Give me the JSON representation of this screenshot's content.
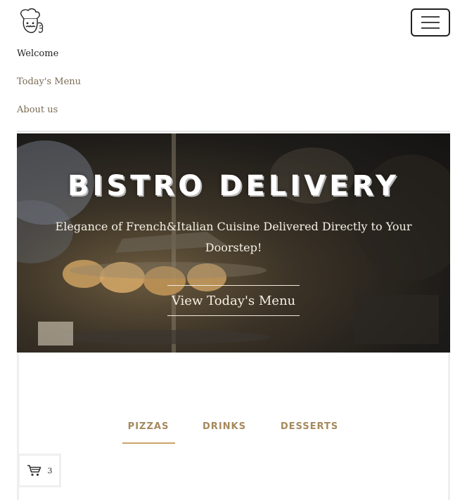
{
  "nav": {
    "items": [
      {
        "label": "Welcome"
      },
      {
        "label": "Today's Menu"
      },
      {
        "label": "About us"
      }
    ]
  },
  "hero": {
    "title": "BISTRO DELIVERY",
    "subtitle": "Elegance of French&Italian Cuisine Delivered Directly to Your Doorstep!",
    "cta_label": "View Today's Menu"
  },
  "menu": {
    "tabs": [
      {
        "label": "PIZZAS",
        "active": true
      },
      {
        "label": "DRINKS",
        "active": false
      },
      {
        "label": "DESSERTS",
        "active": false
      }
    ]
  },
  "cart": {
    "count": "3"
  },
  "icons": {
    "logo": "chef-logo-icon",
    "toggler": "hamburger-menu-icon",
    "cart": "shopping-cart-icon"
  },
  "colors": {
    "accent": "#a5895c",
    "underline": "#c9a46a",
    "nav_muted": "#7a6a52"
  }
}
